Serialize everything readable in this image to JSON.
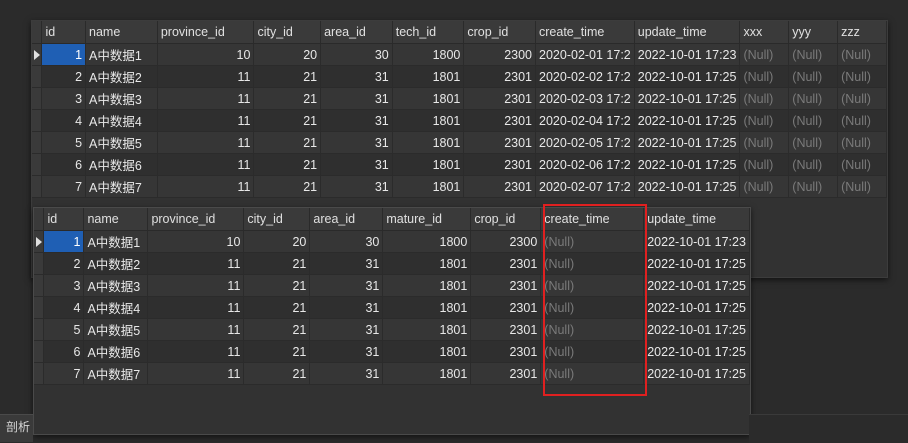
{
  "grid_top": {
    "columns": [
      "id",
      "name",
      "province_id",
      "city_id",
      "area_id",
      "tech_id",
      "crop_id",
      "create_time",
      "update_time",
      "xxx",
      "yyy",
      "zzz"
    ],
    "rows": [
      [
        "1",
        "A中数据1",
        "10",
        "20",
        "30",
        "1800",
        "2300",
        "2020-02-01 17:2",
        "2022-10-01 17:23",
        "(Null)",
        "(Null)",
        "(Null)"
      ],
      [
        "2",
        "A中数据2",
        "11",
        "21",
        "31",
        "1801",
        "2301",
        "2020-02-02 17:2",
        "2022-10-01 17:25",
        "(Null)",
        "(Null)",
        "(Null)"
      ],
      [
        "3",
        "A中数据3",
        "11",
        "21",
        "31",
        "1801",
        "2301",
        "2020-02-03 17:2",
        "2022-10-01 17:25",
        "(Null)",
        "(Null)",
        "(Null)"
      ],
      [
        "4",
        "A中数据4",
        "11",
        "21",
        "31",
        "1801",
        "2301",
        "2020-02-04 17:2",
        "2022-10-01 17:25",
        "(Null)",
        "(Null)",
        "(Null)"
      ],
      [
        "5",
        "A中数据5",
        "11",
        "21",
        "31",
        "1801",
        "2301",
        "2020-02-05 17:2",
        "2022-10-01 17:25",
        "(Null)",
        "(Null)",
        "(Null)"
      ],
      [
        "6",
        "A中数据6",
        "11",
        "21",
        "31",
        "1801",
        "2301",
        "2020-02-06 17:2",
        "2022-10-01 17:25",
        "(Null)",
        "(Null)",
        "(Null)"
      ],
      [
        "7",
        "A中数据7",
        "11",
        "21",
        "31",
        "1801",
        "2301",
        "2020-02-07 17:2",
        "2022-10-01 17:25",
        "(Null)",
        "(Null)",
        "(Null)"
      ]
    ]
  },
  "grid_bottom": {
    "columns": [
      "id",
      "name",
      "province_id",
      "city_id",
      "area_id",
      "mature_id",
      "crop_id",
      "create_time",
      "update_time"
    ],
    "rows": [
      [
        "1",
        "A中数据1",
        "10",
        "20",
        "30",
        "1800",
        "2300",
        "(Null)",
        "2022-10-01 17:23"
      ],
      [
        "2",
        "A中数据2",
        "11",
        "21",
        "31",
        "1801",
        "2301",
        "(Null)",
        "2022-10-01 17:25"
      ],
      [
        "3",
        "A中数据3",
        "11",
        "21",
        "31",
        "1801",
        "2301",
        "(Null)",
        "2022-10-01 17:25"
      ],
      [
        "4",
        "A中数据4",
        "11",
        "21",
        "31",
        "1801",
        "2301",
        "(Null)",
        "2022-10-01 17:25"
      ],
      [
        "5",
        "A中数据5",
        "11",
        "21",
        "31",
        "1801",
        "2301",
        "(Null)",
        "2022-10-01 17:25"
      ],
      [
        "6",
        "A中数据6",
        "11",
        "21",
        "31",
        "1801",
        "2301",
        "(Null)",
        "2022-10-01 17:25"
      ],
      [
        "7",
        "A中数据7",
        "11",
        "21",
        "31",
        "1801",
        "2301",
        "(Null)",
        "2022-10-01 17:25"
      ]
    ]
  },
  "bottom_tab": {
    "label": "剖析"
  },
  "colors": {
    "selection": "#1f5fb4",
    "highlight": "#e02020",
    "null_text": "#7a7a7a"
  }
}
